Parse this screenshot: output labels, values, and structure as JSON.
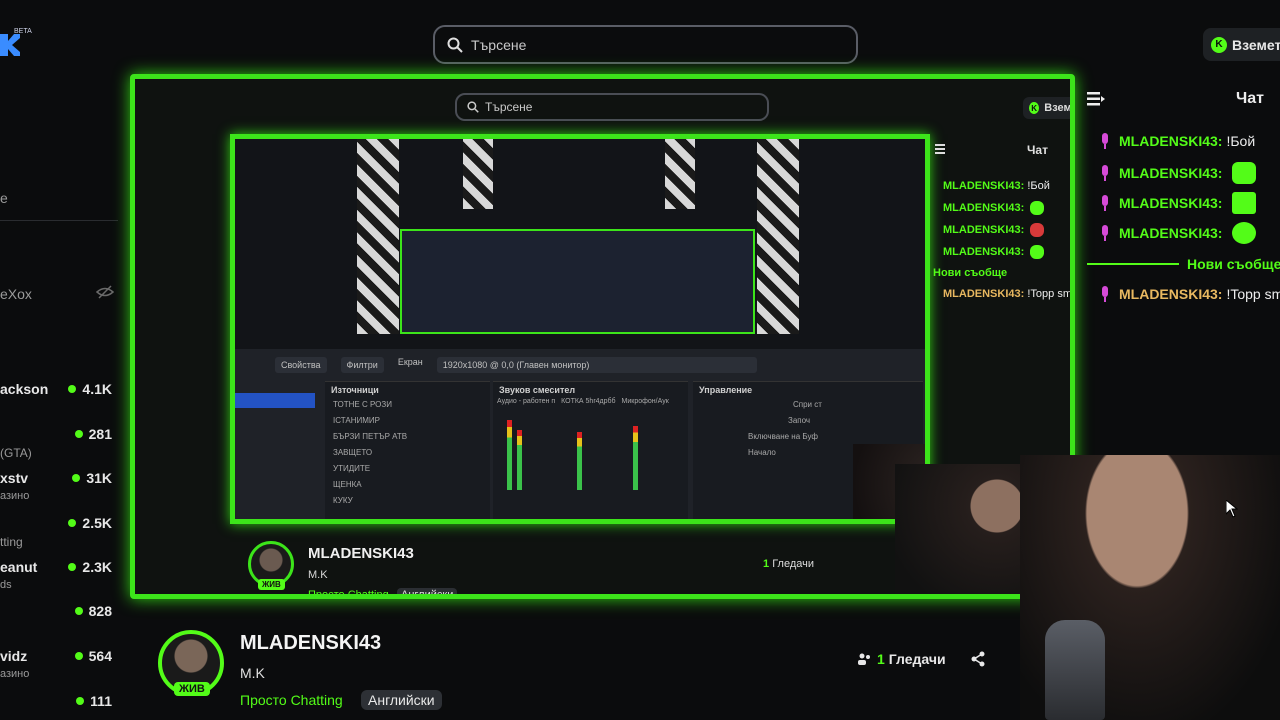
{
  "header": {
    "beta_label": "BETA",
    "search_placeholder": "Търсене",
    "get_button_label": "Вземет"
  },
  "sidebar": {
    "fragments": [
      "е",
      "eXox"
    ],
    "items": [
      {
        "name": "ackson",
        "sub": "",
        "count": "4.1K"
      },
      {
        "name": "",
        "sub": "(GTA)",
        "count": "281"
      },
      {
        "name": "xstv",
        "sub": "азино",
        "count": "31K"
      },
      {
        "name": "",
        "sub": "tting",
        "count": "2.5K"
      },
      {
        "name": "eanut",
        "sub": "ds",
        "count": "2.3K"
      },
      {
        "name": "",
        "sub": "",
        "count": "828"
      },
      {
        "name": "vidz",
        "sub": "азино",
        "count": "564"
      },
      {
        "name": "",
        "sub": "",
        "count": "111"
      }
    ]
  },
  "video": {
    "inner_search_placeholder": "Търсене",
    "inner_get_label": "Вземет",
    "inner_chat_title": "Чат",
    "inner_chat": [
      {
        "user": "MLADENSKI43:",
        "text": "!Бой"
      },
      {
        "user": "MLADENSKI43:",
        "text": ""
      },
      {
        "user": "MLADENSKI43:",
        "text": ""
      },
      {
        "user": "MLADENSKI43:",
        "text": ""
      }
    ],
    "inner_new_messages": "Нови съобще",
    "inner_last_user": "MLADENSKI43:",
    "inner_last_text": "!Topp sm",
    "obs": {
      "tabs": [
        "Свойства",
        "Филтри",
        "Екран",
        "1920x1080 @ 0,0 (Главен монитор)"
      ],
      "sources_title": "Източници",
      "sources": [
        "ТОТНЕ С РОЗИ",
        "ІСТАНИМИР",
        "БЪРЗИ ПЕТЪР АТВ",
        "ЗАВЩЕТО",
        "УТИДИТЕ",
        "ЩЕНКА",
        "КУКУ"
      ],
      "mixer_title": "Звуков смесител",
      "mixer_channels": [
        "Аудио - работен п",
        "КОТКА 5hr4дрбб",
        "Микрофон/Аук"
      ],
      "controls_title": "Управление",
      "controls": [
        "Спри ст",
        "Започ",
        "Включване на Буф",
        "Начало"
      ]
    },
    "inner_streamer": {
      "name": "MLADENSKI43",
      "title": "M.K",
      "category": "Просто Chatting",
      "tag": "Английски",
      "viewers_num": "1",
      "viewers_label": "Гледачи",
      "live": "ЖИВ"
    }
  },
  "chat": {
    "title": "Чат",
    "messages": [
      {
        "user": "MLADENSKI43:",
        "text": "!Бой",
        "emote": ""
      },
      {
        "user": "MLADENSKI43:",
        "text": "",
        "emote": "ghost-emote"
      },
      {
        "user": "MLADENSKI43:",
        "text": "",
        "emote": "angry-emote"
      },
      {
        "user": "MLADENSKI43:",
        "text": "",
        "emote": "smile-emote"
      }
    ],
    "new_messages": "Нови съобще",
    "last_user": "MLADENSKI43:",
    "last_text": "!Topp sm"
  },
  "streamer": {
    "name": "MLADENSKI43",
    "title": "M.K",
    "category": "Просто Chatting",
    "tag": "Английски",
    "viewers_num": "1",
    "viewers_label": "Гледачи",
    "live": "ЖИВ"
  },
  "colors": {
    "accent": "#53fc18",
    "gold_user": "#e8b860",
    "background": "#0b0c0d"
  }
}
